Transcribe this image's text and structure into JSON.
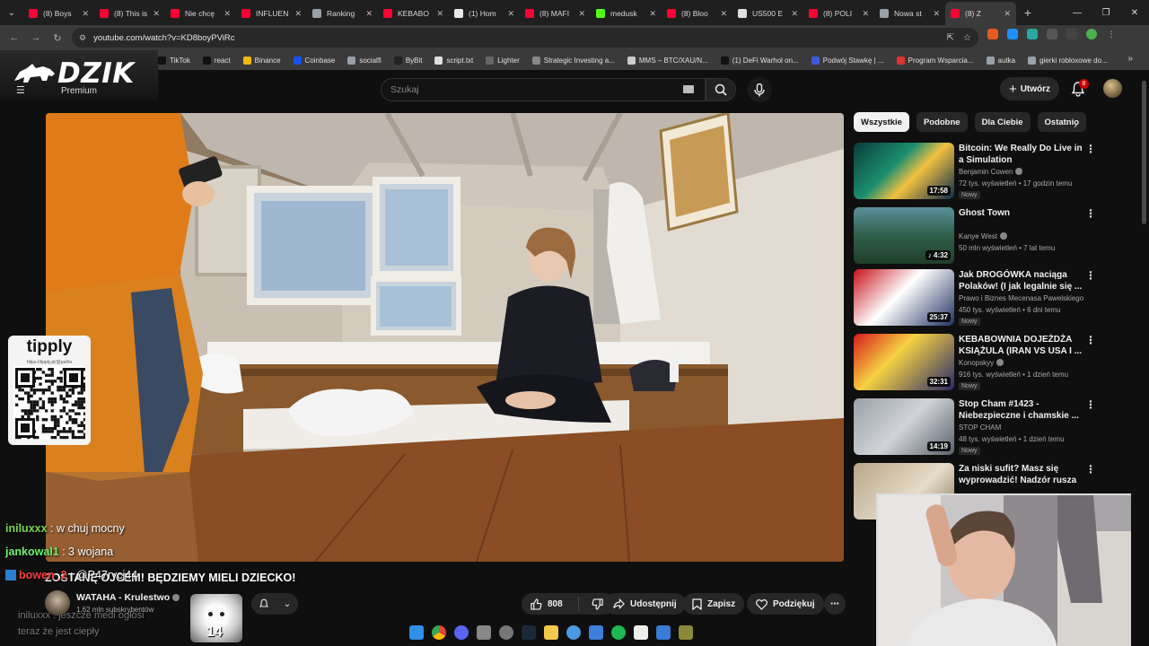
{
  "browser": {
    "tabs": [
      {
        "label": "(8) Boys",
        "color": "#ff0033",
        "active": false
      },
      {
        "label": "(8) This is",
        "color": "#ff0033",
        "active": false
      },
      {
        "label": "Nie chcę",
        "color": "#ff0033",
        "active": false
      },
      {
        "label": "INFLUEN",
        "color": "#ff0033",
        "active": false
      },
      {
        "label": "Ranking",
        "color": "#9aa0a6",
        "active": false
      },
      {
        "label": "KEBABO",
        "color": "#ff0033",
        "active": false
      },
      {
        "label": "(1) Hom",
        "color": "#e7e9ea",
        "active": false
      },
      {
        "label": "(8) MAFI",
        "color": "#ff0033",
        "active": false
      },
      {
        "label": "medusk",
        "color": "#53fc18",
        "active": false
      },
      {
        "label": "(8) Bloo",
        "color": "#ff0033",
        "active": false
      },
      {
        "label": "US500 E",
        "color": "#e0e0e0",
        "active": false
      },
      {
        "label": "(8) POLI",
        "color": "#ff0033",
        "active": false
      },
      {
        "label": "Nowa st",
        "color": "#9aa0a6",
        "active": false
      },
      {
        "label": "(8) Z",
        "color": "#ff0033",
        "active": true
      }
    ],
    "url": "youtube.com/watch?v=KD8boyPViRc",
    "bookmarks": [
      {
        "label": "TikTok",
        "color": "#111111"
      },
      {
        "label": "react",
        "color": "#111111"
      },
      {
        "label": "Binance",
        "color": "#f0b90b"
      },
      {
        "label": "Coinbase",
        "color": "#1652f0"
      },
      {
        "label": "socialfi",
        "color": "#9aa0a6"
      },
      {
        "label": "ByBit",
        "color": "#222222"
      },
      {
        "label": "script.txt",
        "color": "#e0e0e0"
      },
      {
        "label": "Lighter",
        "color": "#666666"
      },
      {
        "label": "Strategic Investing a...",
        "color": "#888888"
      },
      {
        "label": "MMS – BTC/XAU/N...",
        "color": "#cccccc"
      },
      {
        "label": "(1) DeFi Warhol on...",
        "color": "#111111"
      },
      {
        "label": "Podwój Stawkę | ...",
        "color": "#3b5bdb"
      },
      {
        "label": "Program Wsparcia...",
        "color": "#d33"
      },
      {
        "label": "autka",
        "color": "#9aa0a6"
      },
      {
        "label": "gierki robloxowe do...",
        "color": "#9aa0a6"
      }
    ]
  },
  "overlay_logo": {
    "name": "DZIK",
    "sub": "Premium"
  },
  "youtube": {
    "search_placeholder": "Szukaj",
    "create_label": "Utwórz",
    "notifications": "8"
  },
  "tipply": {
    "brand": "tipply",
    "url": "https://tipply.pl/@patho"
  },
  "chat": [
    {
      "user": "iniluxxx",
      "sep": " : ",
      "msg": "w chuj mocny",
      "color": "#78d64b"
    },
    {
      "user": "jankowal1",
      "sep": " : ",
      "msg": "3 wojana",
      "color": "#6cf26c"
    },
    {
      "user": "bowen_2",
      "sep": " : ",
      "msg": "@P47rycj44",
      "color": "#ff3b3b"
    }
  ],
  "chat_faded": [
    {
      "text": "iniluxxx : jeszcze medi ogłosi"
    },
    {
      "text": "teraz że jest ciepły"
    }
  ],
  "banner": "ZOSTANĘ OJCEM! BĘDZIEMY MIELI DZIECKO!",
  "channel": {
    "name": "WATAHA - Krulestwo",
    "subs": "1,62 mln subskrybentów"
  },
  "actions": {
    "likes": "808",
    "share": "Udostępnij",
    "save": "Zapisz",
    "thanks": "Podziękuj"
  },
  "sticker_number": "14",
  "chips": [
    {
      "label": "Wszystkie",
      "active": true
    },
    {
      "label": "Podobne",
      "active": false
    },
    {
      "label": "Dla Ciebie",
      "active": false
    },
    {
      "label": "Ostatnio",
      "active": false
    }
  ],
  "recommendations": [
    {
      "title": "Bitcoin: We Really Do Live in a Simulation",
      "channel": "Benjamin Cowen",
      "verified": true,
      "meta": "72 tys. wyświetleń • 17 godzin temu",
      "badge": "Nowy",
      "duration": "17:58"
    },
    {
      "title": "Ghost Town",
      "channel": "Kanye West",
      "verified": true,
      "meta": "50 mln wyświetleń • 7 lat temu",
      "badge": "",
      "duration": "♪ 4:32"
    },
    {
      "title": "Jak DROGÓWKA naciąga Polaków! (I jak legalnie się ...",
      "channel": "Prawo i Biznes Mecenasa Pawelskiego",
      "verified": false,
      "meta": "450 tys. wyświetleń • 6 dni temu",
      "badge": "Nowy",
      "duration": "25:37"
    },
    {
      "title": "KEBABOWNIA DOJEŻDŻA KSIĄŻULA (IRAN VS USA I ...",
      "channel": "Konopskyy",
      "verified": true,
      "meta": "916 tys. wyświetleń • 1 dzień temu",
      "badge": "Nowy",
      "duration": "32:31"
    },
    {
      "title": "Stop Cham #1423 - Niebezpieczne i chamskie ...",
      "channel": "STOP CHAM",
      "verified": false,
      "meta": "48 tys. wyświetleń • 1 dzień temu",
      "badge": "Nowy",
      "duration": "14:19"
    },
    {
      "title": "Za niski sufit? Masz się wyprowadzić! Nadzór rusza do...",
      "channel": "",
      "verified": false,
      "meta": "",
      "badge": "",
      "duration": ""
    }
  ]
}
